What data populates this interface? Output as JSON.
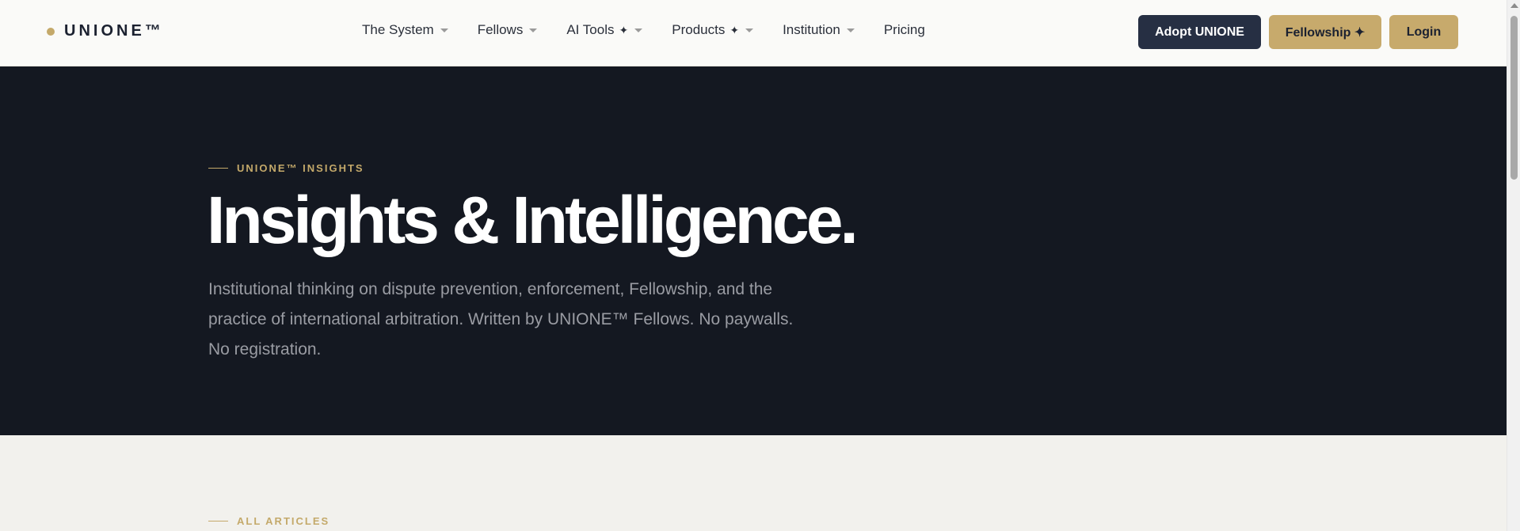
{
  "header": {
    "logo_text": "UNIONE™",
    "nav": [
      {
        "label": "The System",
        "has_caret": true,
        "spark": ""
      },
      {
        "label": "Fellows",
        "has_caret": true,
        "spark": ""
      },
      {
        "label": "AI Tools",
        "has_caret": true,
        "spark": "✦"
      },
      {
        "label": "Products",
        "has_caret": true,
        "spark": "✦"
      },
      {
        "label": "Institution",
        "has_caret": true,
        "spark": ""
      },
      {
        "label": "Pricing",
        "has_caret": false,
        "spark": ""
      }
    ],
    "adopt_label": "Adopt UNIONE",
    "fellowship_label": "Fellowship ✦",
    "login_label": "Login"
  },
  "hero": {
    "eyebrow": "UNIONE™ INSIGHTS",
    "title": "Insights & Intelligence.",
    "description": "Institutional thinking on dispute prevention, enforcement, Fellowship, and the practice of international arbitration. Written by UNIONE™ Fellows. No paywalls. No registration."
  },
  "articles": {
    "eyebrow": "ALL ARTICLES"
  },
  "colors": {
    "accent_gold": "#c4a96a",
    "hero_bg": "#141821",
    "button_dark": "#262f43",
    "page_bg": "#f2f1ed"
  }
}
